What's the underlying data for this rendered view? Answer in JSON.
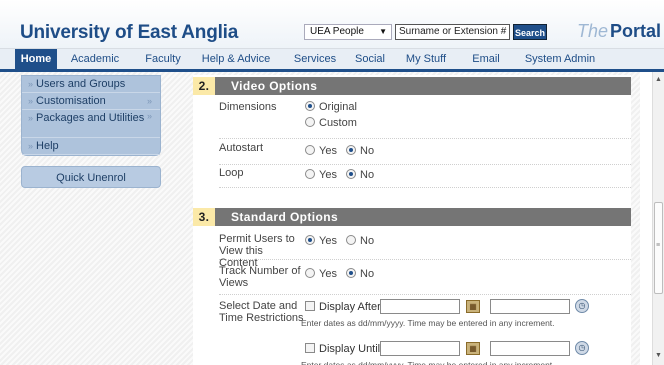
{
  "header": {
    "title": "University of East Anglia",
    "people_select": "UEA People",
    "search_value": "Surname or Extension #",
    "search_button": "Search",
    "portal_prefix": "The",
    "portal_name": "Portal"
  },
  "nav": {
    "items": [
      "Home",
      "Academic",
      "Faculty",
      "Help & Advice",
      "Services",
      "Social",
      "My Stuff",
      "Email",
      "System Admin"
    ],
    "active": "Home"
  },
  "sidebar": {
    "items": [
      {
        "label": "Users and Groups"
      },
      {
        "label": "Customisation"
      },
      {
        "label": "Packages and Utilities"
      },
      {
        "label": "Help"
      }
    ],
    "quick_button": "Quick Unenrol"
  },
  "sections": {
    "video": {
      "number": "2.",
      "title": "Video Options",
      "dimensions_label": "Dimensions",
      "dim_original": "Original",
      "dim_custom": "Custom",
      "autostart_label": "Autostart",
      "loop_label": "Loop",
      "yes": "Yes",
      "no": "No"
    },
    "standard": {
      "number": "3.",
      "title": "Standard Options",
      "permit_label": "Permit Users to View this Content",
      "track_label": "Track Number of Views",
      "date_label": "Select Date and Time Restrictions",
      "display_after": "Display After",
      "display_until": "Display Until",
      "hint": "Enter dates as dd/mm/yyyy. Time may be entered in any increment.",
      "yes": "Yes",
      "no": "No"
    }
  }
}
